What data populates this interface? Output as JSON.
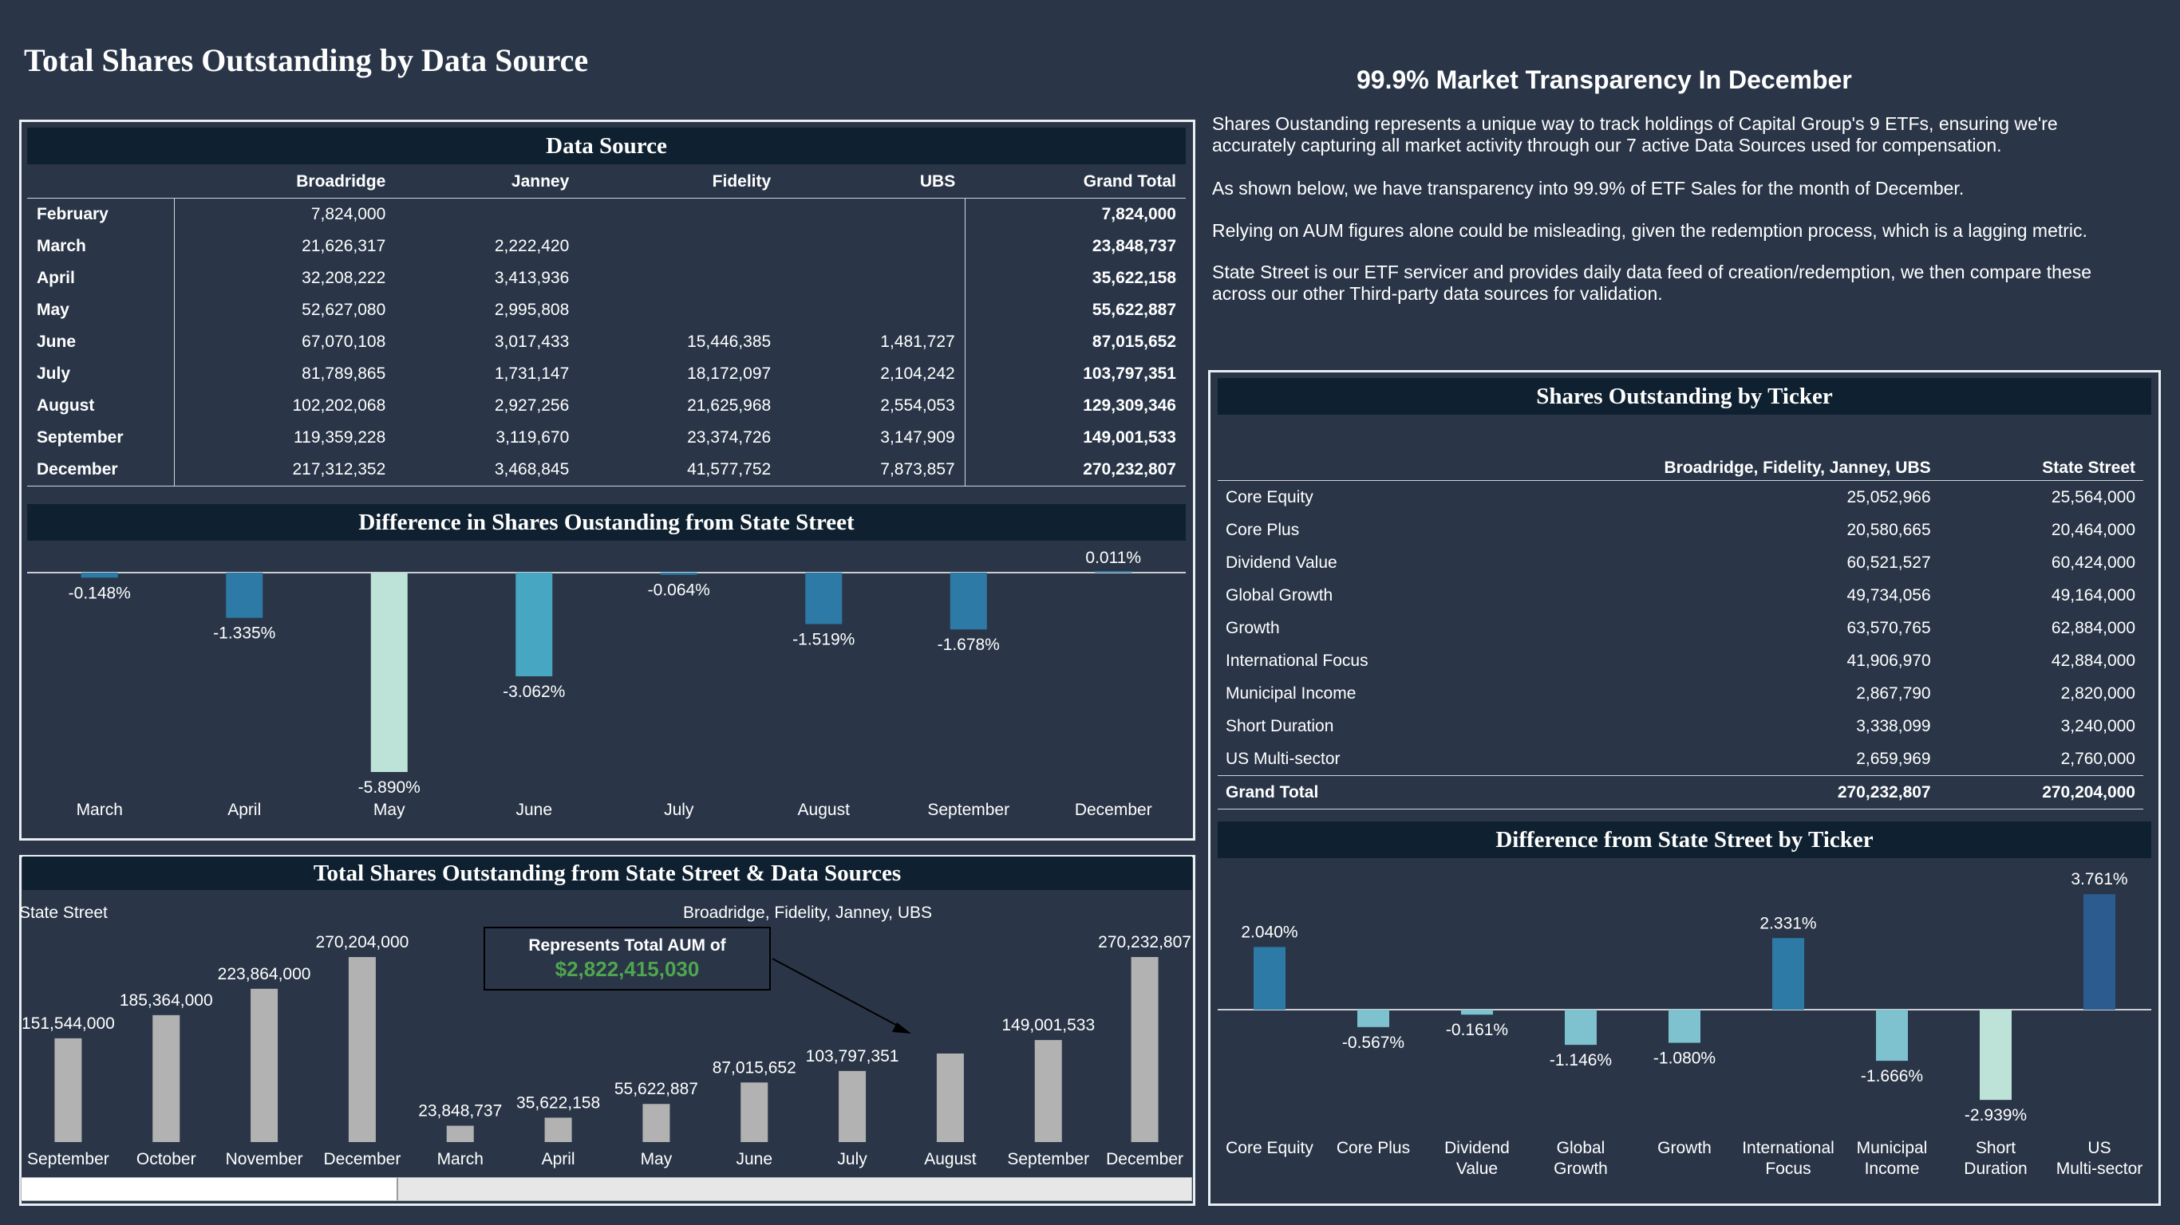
{
  "page": {
    "title": "Total Shares Outstanding by Data Source",
    "headline": "99.9% Market Transparency In December",
    "paragraphs": [
      "Shares Oustanding represents a unique way to track holdings of Capital Group's 9 ETFs, ensuring we're accurately capturing all market activity through our 7 active Data Sources used for compensation.",
      "As shown below, we have transparency into 99.9% of ETF Sales for the month of December.",
      "Relying on AUM figures alone could be misleading, given the redemption process, which is a lagging metric.",
      "State Street is our ETF servicer and provides daily data feed of creation/redemption, we then compare these across our other Third-party data sources for validation."
    ]
  },
  "data_source": {
    "banner": "Data Source",
    "columns": [
      "",
      "Broadridge",
      "Janney",
      "Fidelity",
      "UBS",
      "Grand Total"
    ],
    "rows": [
      [
        "February",
        "7,824,000",
        "",
        "",
        "",
        "7,824,000"
      ],
      [
        "March",
        "21,626,317",
        "2,222,420",
        "",
        "",
        "23,848,737"
      ],
      [
        "April",
        "32,208,222",
        "3,413,936",
        "",
        "",
        "35,622,158"
      ],
      [
        "May",
        "52,627,080",
        "2,995,808",
        "",
        "",
        "55,622,887"
      ],
      [
        "June",
        "67,070,108",
        "3,017,433",
        "15,446,385",
        "1,481,727",
        "87,015,652"
      ],
      [
        "July",
        "81,789,865",
        "1,731,147",
        "18,172,097",
        "2,104,242",
        "103,797,351"
      ],
      [
        "August",
        "102,202,068",
        "2,927,256",
        "21,625,968",
        "2,554,053",
        "129,309,346"
      ],
      [
        "September",
        "119,359,228",
        "3,119,670",
        "23,374,726",
        "3,147,909",
        "149,001,533"
      ],
      [
        "December",
        "217,312,352",
        "3,468,845",
        "41,577,752",
        "7,873,857",
        "270,232,807"
      ]
    ]
  },
  "ticker_table": {
    "banner": "Shares Outstanding by Ticker",
    "columns": [
      "",
      "Broadridge, Fidelity, Janney, UBS",
      "State Street"
    ],
    "rows": [
      [
        "Core Equity",
        "25,052,966",
        "25,564,000"
      ],
      [
        "Core Plus",
        "20,580,665",
        "20,464,000"
      ],
      [
        "Dividend Value",
        "60,521,527",
        "60,424,000"
      ],
      [
        "Global Growth",
        "49,734,056",
        "49,164,000"
      ],
      [
        "Growth",
        "63,570,765",
        "62,884,000"
      ],
      [
        "International Focus",
        "41,906,970",
        "42,884,000"
      ],
      [
        "Municipal Income",
        "2,867,790",
        "2,820,000"
      ],
      [
        "Short Duration",
        "3,338,099",
        "3,240,000"
      ],
      [
        "US Multi-sector",
        "2,659,969",
        "2,760,000"
      ]
    ],
    "total": [
      "Grand Total",
      "270,232,807",
      "270,204,000"
    ]
  },
  "aum_callout": {
    "label": "Represents Total AUM of",
    "value": "$2,822,415,030"
  },
  "colors": {
    "background": "#2a3648",
    "banner": "#0f2130",
    "dark_blue": "#2d7aa6",
    "teal": "#47a7c2",
    "light_teal": "#7ec2cf",
    "mint": "#bde3d9",
    "navy": "#2c5b8f",
    "gray_bar": "#b2b2b2",
    "green_text": "#4fa64f"
  },
  "chart_data": [
    {
      "type": "bar",
      "title": "Difference in Shares Oustanding from State Street",
      "categories": [
        "March",
        "April",
        "May",
        "June",
        "July",
        "August",
        "September",
        "December"
      ],
      "values": [
        -0.148,
        -1.335,
        -5.89,
        -3.062,
        -0.064,
        -1.519,
        -1.678,
        0.011
      ],
      "labels": [
        "-0.148%",
        "-1.335%",
        "-5.890%",
        "-3.062%",
        "-0.064%",
        "-1.519%",
        "-1.678%",
        "0.011%"
      ],
      "bar_colors": [
        "#2d7aa6",
        "#2d7aa6",
        "#bde3d9",
        "#47a7c2",
        "#2d7aa6",
        "#2d7aa6",
        "#2d7aa6",
        "#2d7aa6"
      ],
      "ylim": [
        -5.89,
        0.011
      ]
    },
    {
      "type": "bar",
      "title": "Total Shares Outstanding from State Street & Data Sources",
      "groups": [
        {
          "name": "State Street",
          "categories": [
            "September",
            "October",
            "November",
            "December"
          ],
          "values": [
            151544000,
            185364000,
            223864000,
            270204000
          ],
          "labels": [
            "151,544,000",
            "185,364,000",
            "223,864,000",
            "270,204,000"
          ]
        },
        {
          "name": "Broadridge, Fidelity, Janney, UBS",
          "categories": [
            "March",
            "April",
            "May",
            "June",
            "July",
            "August",
            "September",
            "December"
          ],
          "values": [
            23848737,
            35622158,
            55622887,
            87015652,
            103797351,
            129309346,
            149001533,
            270232807
          ],
          "labels": [
            "23,848,737",
            "35,622,158",
            "55,622,887",
            "87,015,652",
            "103,797,351",
            "",
            "149,001,533",
            "270,232,807"
          ]
        }
      ],
      "ylim": [
        0,
        270232807
      ]
    },
    {
      "type": "bar",
      "title": "Difference from State Street by Ticker",
      "categories": [
        "Core Equity",
        "Core Plus",
        "Dividend Value",
        "Global Growth",
        "Growth",
        "International Focus",
        "Municipal Income",
        "Short Duration",
        "US Multi-sector"
      ],
      "category_lines": [
        [
          "Core Equity"
        ],
        [
          "Core Plus"
        ],
        [
          "Dividend",
          "Value"
        ],
        [
          "Global",
          "Growth"
        ],
        [
          "Growth"
        ],
        [
          "International",
          "Focus"
        ],
        [
          "Municipal",
          "Income"
        ],
        [
          "Short",
          "Duration"
        ],
        [
          "US",
          "Multi-sector"
        ]
      ],
      "values": [
        2.04,
        -0.567,
        -0.161,
        -1.146,
        -1.08,
        2.331,
        -1.666,
        -2.939,
        3.761
      ],
      "labels": [
        "2.040%",
        "-0.567%",
        "-0.161%",
        "-1.146%",
        "-1.080%",
        "2.331%",
        "-1.666%",
        "-2.939%",
        "3.761%"
      ],
      "bar_colors": [
        "#2d7aa6",
        "#7ec2cf",
        "#7ec2cf",
        "#7ec2cf",
        "#7ec2cf",
        "#2d7aa6",
        "#7ec2cf",
        "#bde3d9",
        "#2c5b8f"
      ],
      "ylim": [
        -2.939,
        3.761
      ]
    }
  ]
}
